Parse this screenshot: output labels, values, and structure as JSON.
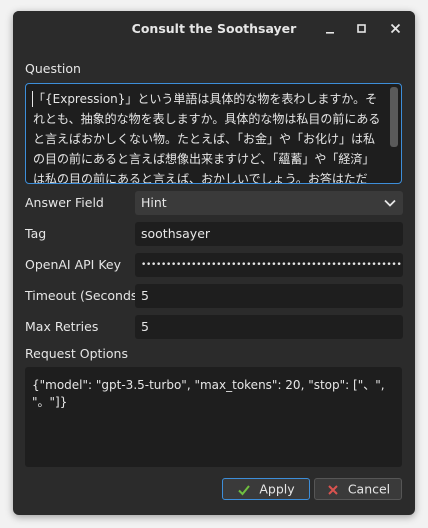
{
  "window": {
    "title": "Consult the Soothsayer"
  },
  "form": {
    "question_label": "Question",
    "question_value": "「{Expression}」という単語は具体的な物を表わしますか。それとも、抽象的な物を表しますか。具体的な物は私目の前にあると言えばおかしくない物。たとえば、「お金」や「お化け」は私の目の前にあると言えば想像出来ますけど、「蘊蓄」や「経済」は私の目の前にあると言えば、おかしいでしょう。お答はただ「具",
    "answer_field_label": "Answer Field",
    "answer_field_value": "Hint",
    "tag_label": "Tag",
    "tag_value": "soothsayer",
    "api_key_label": "OpenAI API Key",
    "api_key_value": "••••••••••••••••••••••••••••••••••••••••••••••••••••",
    "timeout_label": "Timeout (Seconds)",
    "timeout_value": "5",
    "retries_label": "Max Retries",
    "retries_value": "5",
    "request_options_label": "Request Options",
    "request_options_value": "{\"model\": \"gpt-3.5-turbo\", \"max_tokens\": 20, \"stop\": [\"、\", \"。\"]}"
  },
  "buttons": {
    "apply_label": "Apply",
    "cancel_label": "Cancel"
  },
  "icons": {
    "minimize": "minimize-icon",
    "maximize": "maximize-icon",
    "close": "close-icon",
    "dropdown": "chevron-down-icon",
    "apply": "check-icon",
    "cancel": "x-icon"
  },
  "colors": {
    "window_bg": "#2b2b2b",
    "field_bg": "#1e1e1e",
    "focus": "#3d8ed9",
    "apply_icon": "#6fbf3f",
    "cancel_icon": "#d9534f"
  }
}
